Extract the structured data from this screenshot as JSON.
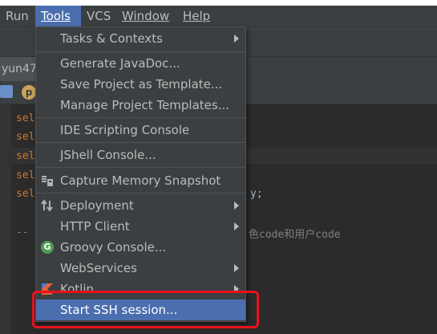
{
  "menubar": {
    "items": [
      "Run",
      "Tools",
      "VCS",
      "Window",
      "Help"
    ],
    "active": "Tools"
  },
  "tab": {
    "label": "yun47."
  },
  "toolbar": {
    "p_icon_label": "p"
  },
  "editor": {
    "lines": [
      "sel",
      "sel",
      "sel",
      "sel",
      "sel"
    ],
    "fragment_right": "y;",
    "comment_prefix": "--",
    "comment_text": "色code和用户code"
  },
  "tools_menu": {
    "items": [
      {
        "label": "Tasks & Contexts",
        "submenu": true
      },
      {
        "label": "Generate JavaDoc..."
      },
      {
        "label": "Save Project as Template..."
      },
      {
        "label": "Manage Project Templates..."
      },
      {
        "label": "IDE Scripting Console"
      },
      {
        "label": "JShell Console..."
      },
      {
        "label": "Capture Memory Snapshot",
        "icon": "memory-snapshot-icon"
      },
      {
        "label": "Deployment",
        "submenu": true,
        "icon": "deployment-arrows-icon"
      },
      {
        "label": "HTTP Client",
        "submenu": true
      },
      {
        "label": "Groovy Console...",
        "icon": "groovy-icon"
      },
      {
        "label": "WebServices",
        "submenu": true
      },
      {
        "label": "Kotlin",
        "submenu": true,
        "icon": "kotlin-icon"
      },
      {
        "label": "Start SSH session...",
        "selected": true
      }
    ],
    "groovy_icon_letter": "G"
  },
  "colors": {
    "menu_bg": "#3c3f41",
    "selection": "#4b6eaf",
    "highlight_box": "#e8121d",
    "keyword": "#cc7832"
  }
}
